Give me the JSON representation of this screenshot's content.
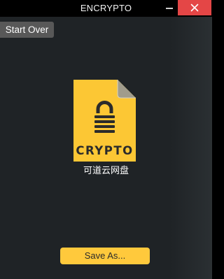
{
  "window": {
    "title": "ENCRYPTO",
    "close_color": "#e44646"
  },
  "toolbar": {
    "start_over_label": "Start Over"
  },
  "file": {
    "icon": "encrypted-file-icon",
    "badge_text": "CRYPTO",
    "name": "可道云网盘",
    "icon_color": "#fcc734"
  },
  "actions": {
    "save_as_label": "Save As...",
    "accent_color": "#ffc93c"
  }
}
